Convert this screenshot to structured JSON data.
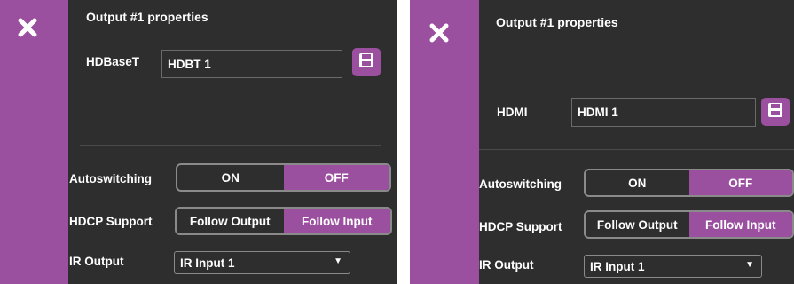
{
  "panels": [
    {
      "title": "Output #1 properties",
      "name_label": "HDBaseT",
      "name_value": "HDBT  1",
      "save_icon": "floppy-disk-icon",
      "autoswitching": {
        "label": "Autoswitching",
        "on": "ON",
        "off": "OFF",
        "selected": "OFF"
      },
      "hdcp": {
        "label": "HDCP Support",
        "follow_output": "Follow Output",
        "follow_input": "Follow Input",
        "selected": "Follow Input"
      },
      "ir_output": {
        "label": "IR Output",
        "value": "IR Input 1"
      }
    },
    {
      "title": "Output #1 properties",
      "name_label": "HDMI",
      "name_value": "HDMI  1",
      "save_icon": "floppy-disk-icon",
      "autoswitching": {
        "label": "Autoswitching",
        "on": "ON",
        "off": "OFF",
        "selected": "OFF"
      },
      "hdcp": {
        "label": "HDCP Support",
        "follow_output": "Follow Output",
        "follow_input": "Follow Input",
        "selected": "Follow Input"
      },
      "ir_output": {
        "label": "IR Output",
        "value": "IR Input 1"
      }
    }
  ],
  "colors": {
    "accent": "#9b4f9f",
    "panel_bg": "#2e2e2e",
    "text": "#ffffff",
    "border": "#8a8a8a"
  }
}
